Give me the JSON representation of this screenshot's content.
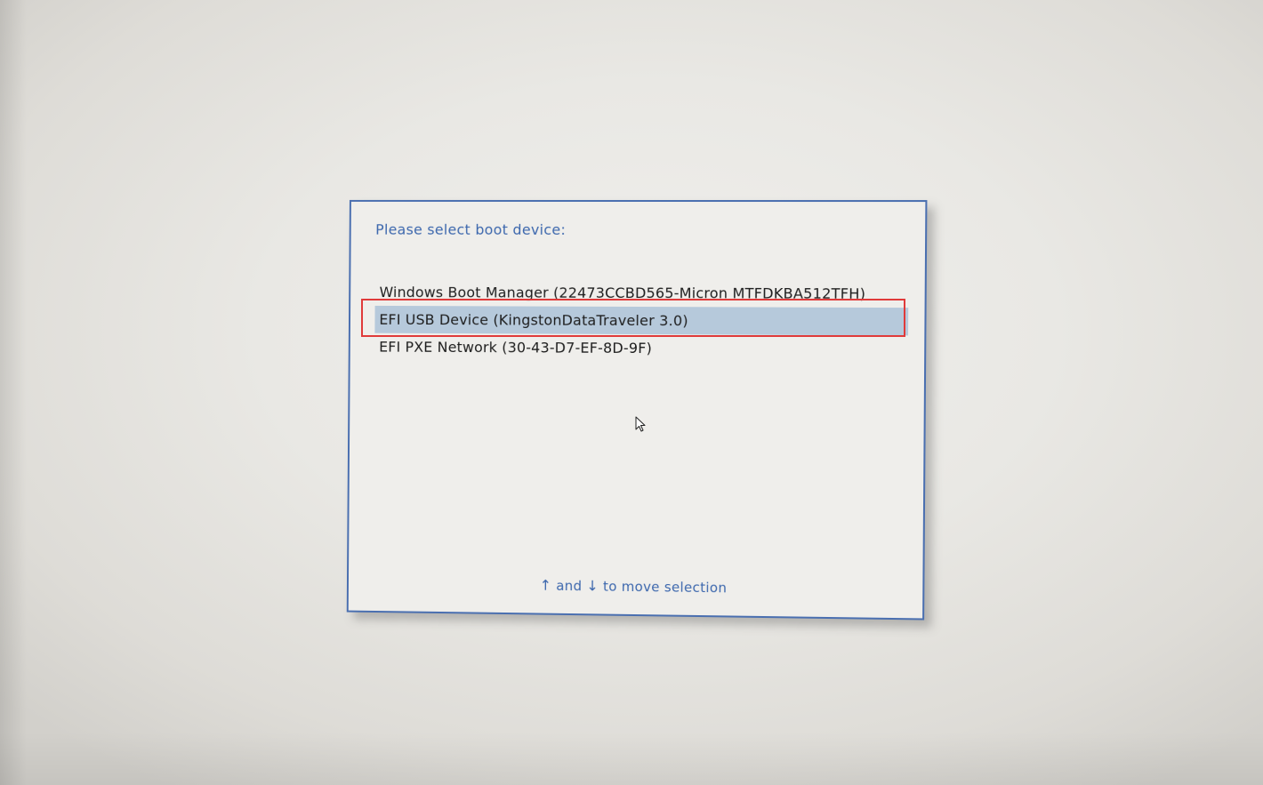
{
  "boot_menu": {
    "prompt": "Please select boot device:",
    "items": [
      {
        "label": "Windows Boot Manager (22473CCBD565-Micron MTFDKBA512TFH)",
        "selected": false
      },
      {
        "label": "EFI USB Device (KingstonDataTraveler 3.0)",
        "selected": true
      },
      {
        "label": "EFI PXE Network (30-43-D7-EF-8D-9F)",
        "selected": false
      }
    ],
    "hint": {
      "up_arrow": "↑",
      "and_text": "and",
      "down_arrow": "↓",
      "action_text": "to move selection"
    }
  },
  "colors": {
    "dialog_border": "#4a6fb0",
    "prompt_text": "#3c67ad",
    "selection_background": "#b6c9db",
    "annotation_highlight": "#e03a3a"
  },
  "icons": {
    "cursor": "mouse-pointer-icon",
    "up": "up-arrow-icon",
    "down": "down-arrow-icon"
  }
}
